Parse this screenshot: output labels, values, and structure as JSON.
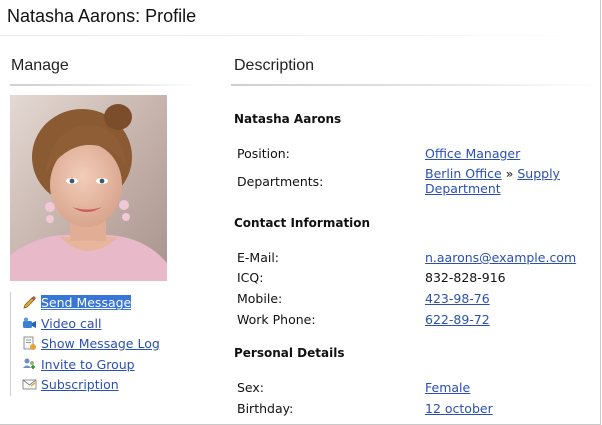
{
  "page": {
    "title": "Natasha Aarons: Profile"
  },
  "manage": {
    "heading": "Manage",
    "actions": [
      {
        "label": "Send Message",
        "icon": "pencil-icon",
        "selected": true
      },
      {
        "label": "Video call",
        "icon": "video-camera-icon"
      },
      {
        "label": "Show Message Log",
        "icon": "message-log-icon"
      },
      {
        "label": "Invite to Group",
        "icon": "invite-group-icon"
      },
      {
        "label": "Subscription",
        "icon": "envelope-icon"
      }
    ]
  },
  "description": {
    "heading": "Description",
    "name_group": {
      "title": "Natasha Aarons",
      "position_label": "Position:",
      "position_value": "Office Manager",
      "departments_label": "Departments:",
      "dept_1": "Berlin Office",
      "dept_sep": "»",
      "dept_2": "Supply Department"
    },
    "contact": {
      "title": "Contact Information",
      "email_label": "E-Mail:",
      "email_value": "n.aarons@example.com",
      "icq_label": "ICQ:",
      "icq_value": "832-828-916",
      "mobile_label": "Mobile:",
      "mobile_value": "423-98-76",
      "work_label": "Work Phone:",
      "work_value": "622-89-72"
    },
    "personal": {
      "title": "Personal Details",
      "sex_label": "Sex:",
      "sex_value": "Female",
      "birthday_label": "Birthday:",
      "birthday_value": "12 october"
    }
  },
  "colors": {
    "link": "#2b4fb5",
    "selection": "#3875d7"
  }
}
